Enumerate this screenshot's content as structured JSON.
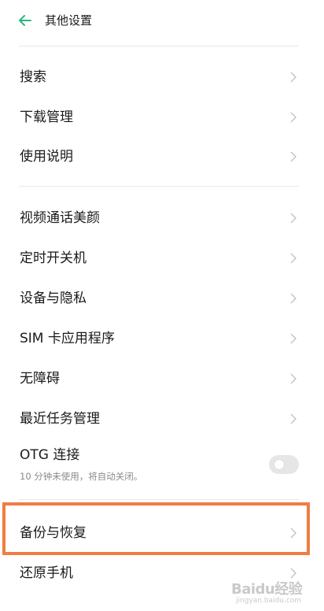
{
  "header": {
    "title": "其他设置"
  },
  "sections": [
    {
      "items": [
        {
          "label": "搜索"
        },
        {
          "label": "下载管理"
        },
        {
          "label": "使用说明"
        }
      ]
    },
    {
      "items": [
        {
          "label": "视频通话美颜"
        },
        {
          "label": "定时开关机"
        },
        {
          "label": "设备与隐私"
        },
        {
          "label": "SIM 卡应用程序"
        },
        {
          "label": "无障碍"
        },
        {
          "label": "最近任务管理"
        }
      ]
    }
  ],
  "otg": {
    "title": "OTG 连接",
    "subtitle": "10 分钟未使用，将自动关闭。",
    "enabled": false
  },
  "backup": {
    "label": "备份与恢复"
  },
  "reset": {
    "label": "还原手机"
  },
  "watermark": {
    "text": "Baidu经验",
    "sub": "jingyan.baidu.com"
  },
  "colors": {
    "accent": "#2bb67e",
    "highlight": "#ef7d43",
    "chevron": "#c6c6c6"
  }
}
